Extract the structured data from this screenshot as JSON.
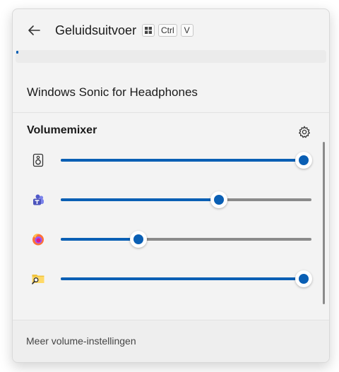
{
  "header": {
    "title": "Geluidsuitvoer",
    "shortcut": {
      "key1": "Ctrl",
      "key2": "V"
    }
  },
  "device": {
    "name": "Windows Sonic for Headphones"
  },
  "mixer": {
    "title": "Volumemixer",
    "items": [
      {
        "icon": "speaker-icon",
        "volume_percent": 97
      },
      {
        "icon": "teams-icon",
        "volume_percent": 63
      },
      {
        "icon": "firefox-icon",
        "volume_percent": 31
      },
      {
        "icon": "file-explorer-icon",
        "volume_percent": 97
      }
    ]
  },
  "footer": {
    "link": "Meer volume-instellingen"
  },
  "colors": {
    "accent": "#0a5fb4",
    "track": "#8a8a8a",
    "background": "#f3f3f3"
  }
}
